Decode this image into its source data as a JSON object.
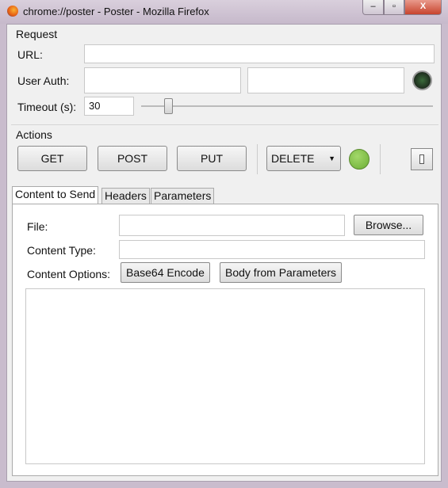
{
  "window": {
    "title": "chrome://poster - Poster - Mozilla Firefox",
    "minimize": "‒",
    "maximize": "▫",
    "close": "X"
  },
  "request": {
    "heading": "Request",
    "url_label": "URL:",
    "url_value": "",
    "auth_label": "User Auth:",
    "auth_user": "",
    "auth_pass": "",
    "timeout_label": "Timeout (s):",
    "timeout_value": "30",
    "timeout_slider_fraction": 0.1
  },
  "actions": {
    "heading": "Actions",
    "get": "GET",
    "post": "POST",
    "put": "PUT",
    "method_select": "DELETE",
    "status_color": "#7dc243"
  },
  "tabs": [
    {
      "label": "Content to Send",
      "active": true
    },
    {
      "label": "Headers"
    },
    {
      "label": "Parameters"
    }
  ],
  "content": {
    "file_label": "File:",
    "file_value": "",
    "browse": "Browse...",
    "type_label": "Content Type:",
    "type_value": "",
    "options_label": "Content Options:",
    "base64": "Base64 Encode",
    "body_params": "Body from Parameters",
    "body_text": ""
  }
}
